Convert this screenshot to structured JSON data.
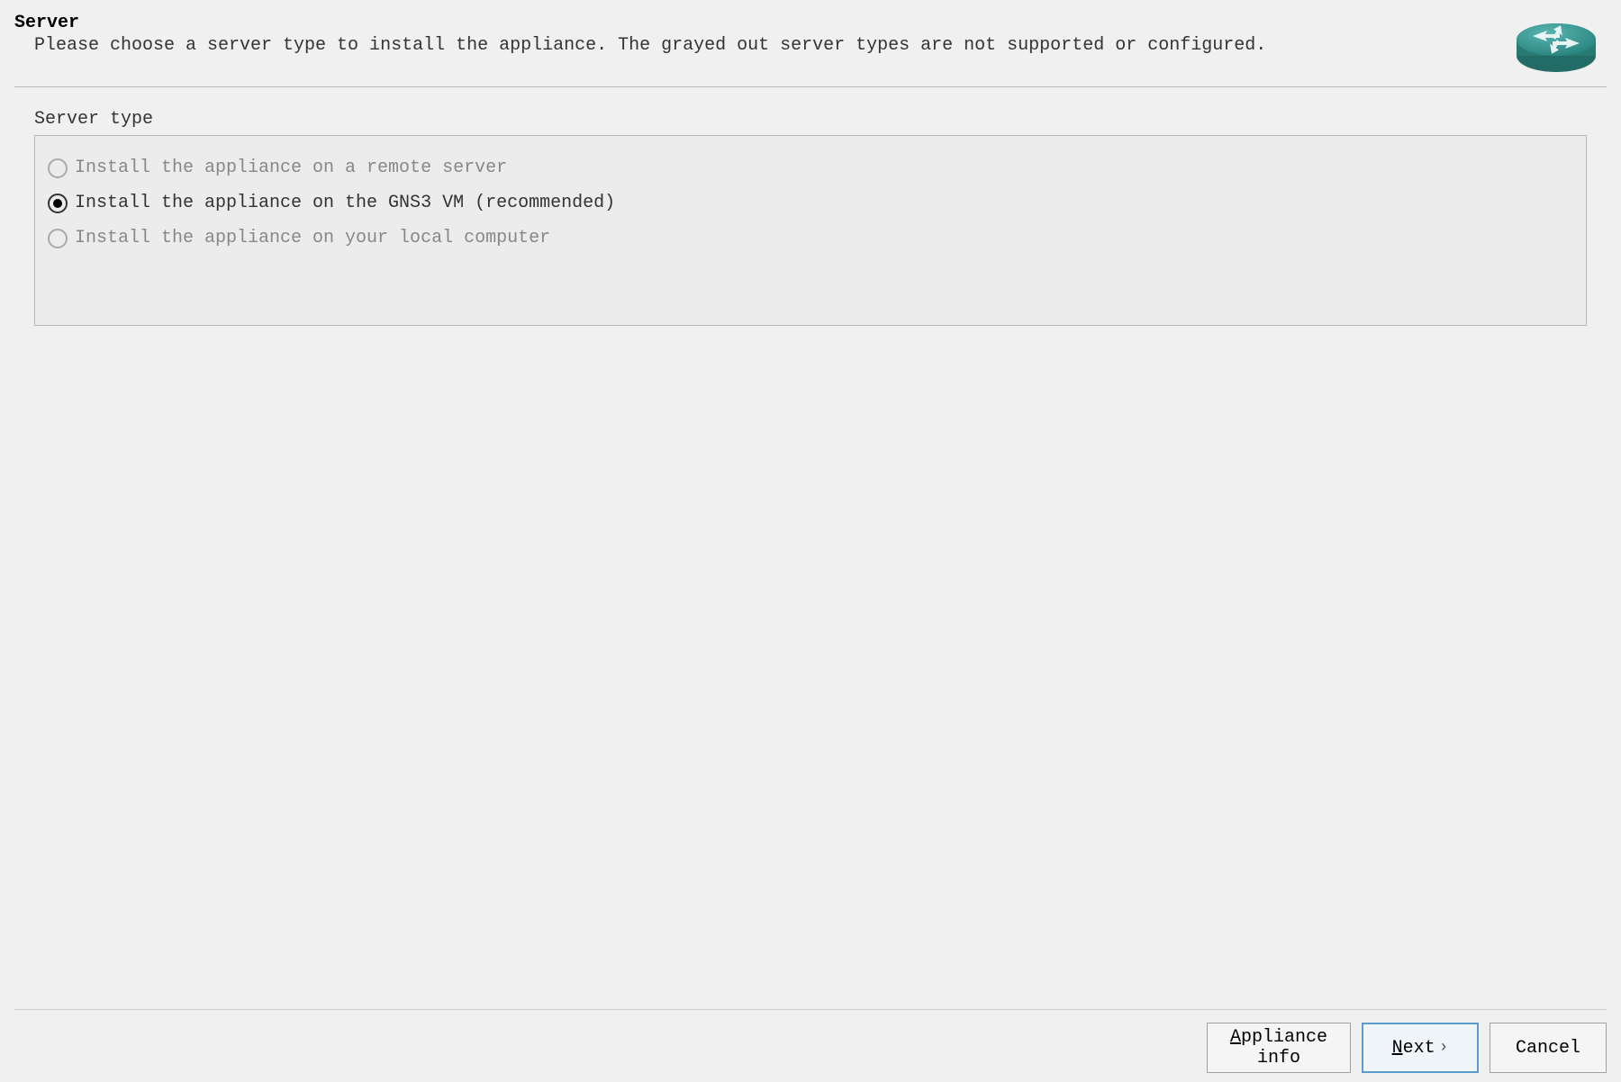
{
  "header": {
    "title": "Server",
    "subtitle": "Please choose a server type to install the appliance. The grayed out server types are not supported or configured."
  },
  "section": {
    "label": "Server type"
  },
  "options": [
    {
      "label": "Install the appliance on a remote server",
      "enabled": false,
      "selected": false
    },
    {
      "label": "Install the appliance on the GNS3 VM (recommended)",
      "enabled": true,
      "selected": true
    },
    {
      "label": "Install the appliance on your local computer",
      "enabled": false,
      "selected": false
    }
  ],
  "buttons": {
    "appliance_info": "Appliance info",
    "next": "Next",
    "cancel": "Cancel"
  }
}
